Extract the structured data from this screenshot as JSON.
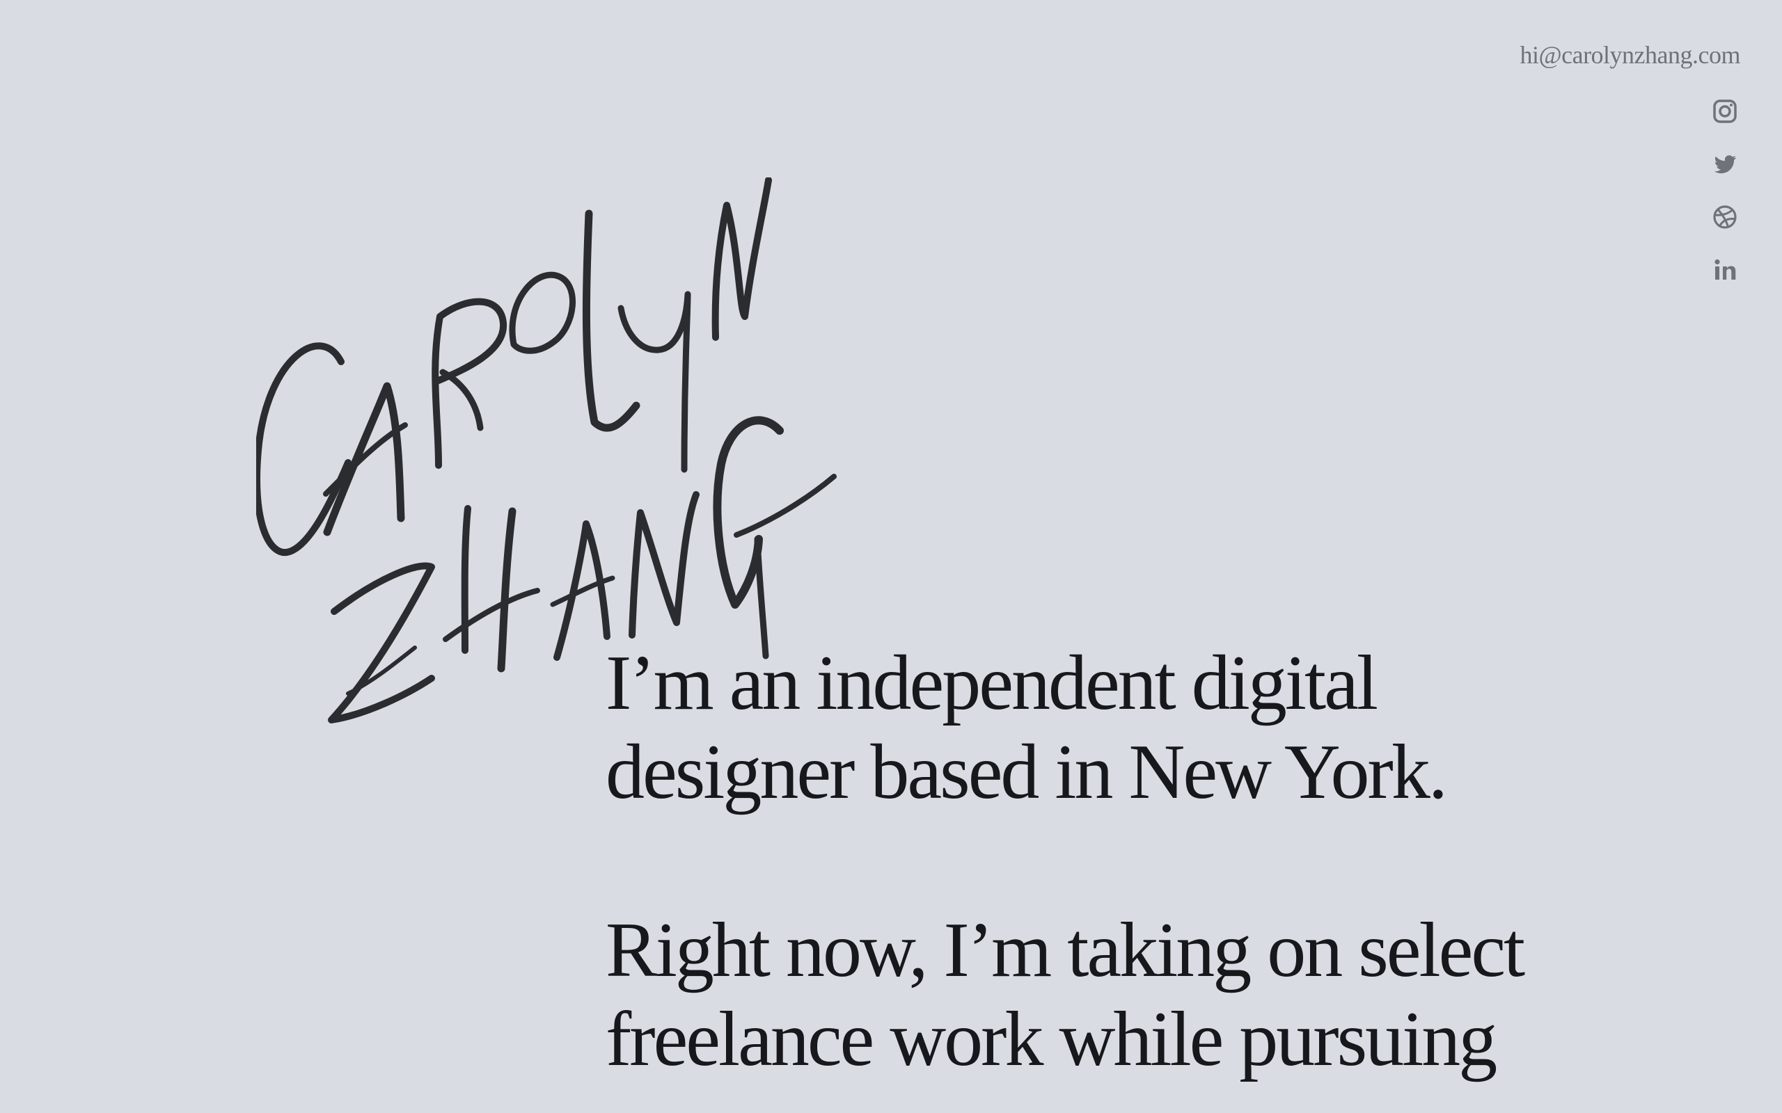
{
  "header": {
    "email": "hi@carolynzhang.com"
  },
  "social": [
    {
      "icon": "instagram-icon",
      "label": "Instagram"
    },
    {
      "icon": "twitter-icon",
      "label": "Twitter"
    },
    {
      "icon": "dribbble-icon",
      "label": "Dribbble"
    },
    {
      "icon": "linkedin-icon",
      "label": "LinkedIn"
    }
  ],
  "logo": {
    "text_line1": "CAROLYN",
    "text_line2": "ZHANG"
  },
  "intro": {
    "paragraph1": "I’m an independent digital designer based in New York.",
    "paragraph2": "Right now, I’m taking on select freelance work while pursuing"
  },
  "colors": {
    "background": "#d9dde3",
    "text": "#16181b",
    "muted": "#6f7277"
  }
}
